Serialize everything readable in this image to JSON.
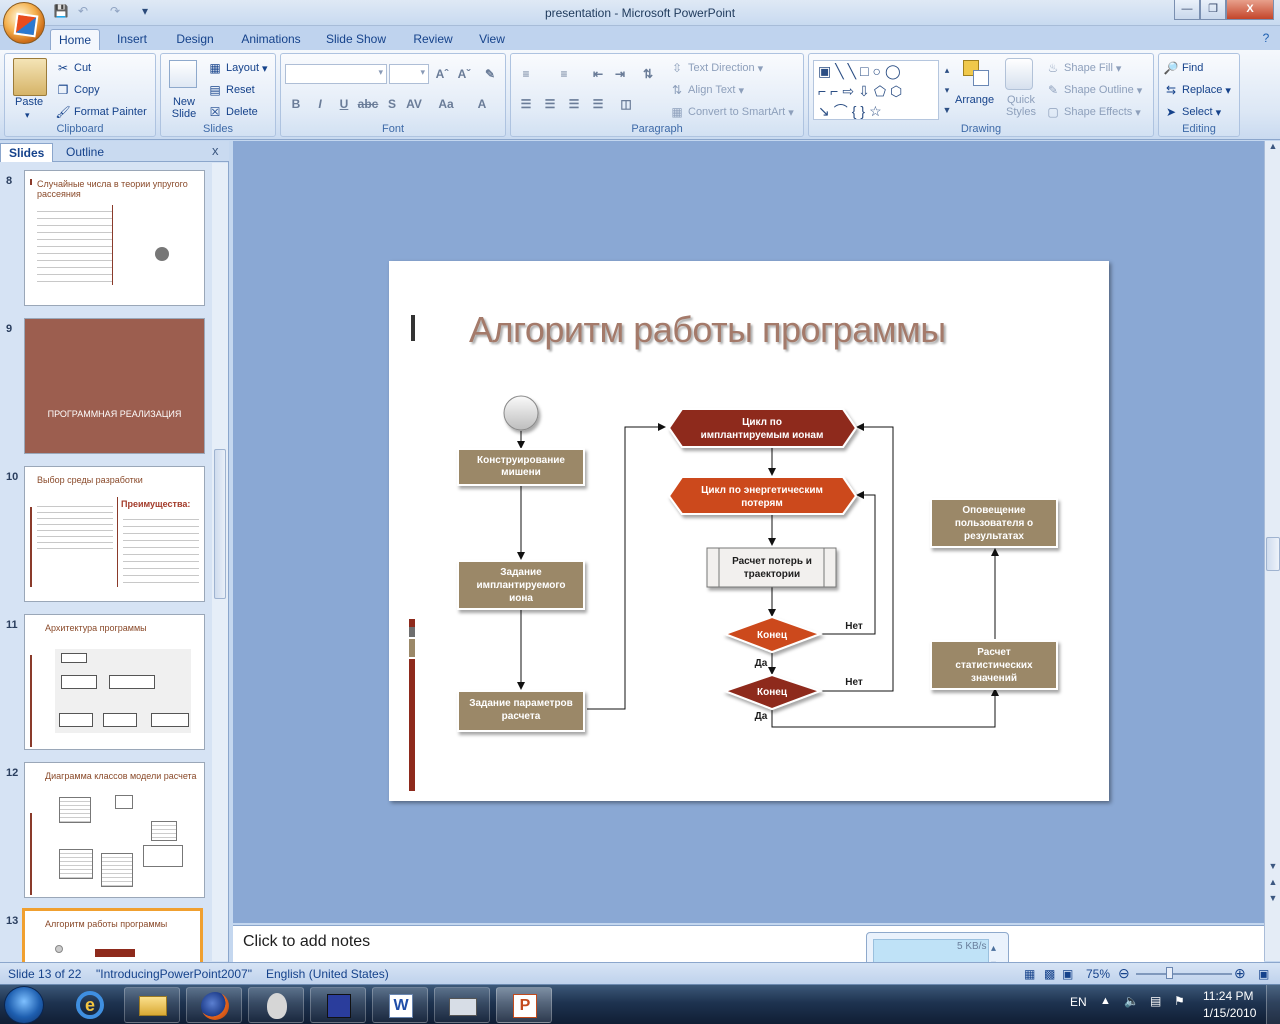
{
  "window": {
    "title": "presentation - Microsoft PowerPoint"
  },
  "qat": [
    "save-icon",
    "undo-icon",
    "redo-icon",
    "customize-icon"
  ],
  "tabs": [
    "Home",
    "Insert",
    "Design",
    "Animations",
    "Slide Show",
    "Review",
    "View"
  ],
  "active_tab": "Home",
  "ribbon": {
    "clipboard": {
      "label": "Clipboard",
      "paste": "Paste",
      "cut": "Cut",
      "copy": "Copy",
      "format_painter": "Format Painter"
    },
    "slides": {
      "label": "Slides",
      "new_slide": "New Slide",
      "layout": "Layout",
      "reset": "Reset",
      "delete": "Delete"
    },
    "font": {
      "label": "Font"
    },
    "paragraph": {
      "label": "Paragraph",
      "text_direction": "Text Direction",
      "align_text": "Align Text",
      "convert_smartart": "Convert to SmartArt"
    },
    "drawing": {
      "label": "Drawing",
      "arrange": "Arrange",
      "quick_styles": "Quick Styles",
      "shape_fill": "Shape Fill",
      "shape_outline": "Shape Outline",
      "shape_effects": "Shape Effects"
    },
    "editing": {
      "label": "Editing",
      "find": "Find",
      "replace": "Replace",
      "select": "Select"
    }
  },
  "pane": {
    "tab_slides": "Slides",
    "tab_outline": "Outline",
    "close": "x"
  },
  "thumbnails": [
    {
      "num": "8",
      "title": "Случайные числа в теории упругого рассеяния"
    },
    {
      "num": "9",
      "title": "ПРОГРАММНАЯ РЕАЛИЗАЦИЯ"
    },
    {
      "num": "10",
      "title": "Выбор среды разработки",
      "side": "Преимущества:"
    },
    {
      "num": "11",
      "title": "Архитектура программы"
    },
    {
      "num": "12",
      "title": "Диаграмма классов модели расчета"
    },
    {
      "num": "13",
      "title": "Алгоритм работы программы"
    }
  ],
  "slide": {
    "title": "Алгоритм работы программы",
    "nodes": {
      "construct": [
        "Конструирование",
        "мишени"
      ],
      "implant": [
        "Задание",
        "имплантируемого",
        "иона"
      ],
      "params": [
        "Задание параметров",
        "расчета"
      ],
      "loop_ions": [
        "Цикл по",
        "имплантируемым ионам"
      ],
      "loop_energy": [
        "Цикл по энергетическим",
        "потерям"
      ],
      "calc_loss": [
        "Расчет потерь и",
        "траектории"
      ],
      "end1": "Конец",
      "end2": "Конец",
      "stats": [
        "Расчет",
        "статистических",
        "значений"
      ],
      "notify": [
        "Оповещение",
        "пользователя о",
        "результатах"
      ]
    },
    "labels": {
      "no1": "Нет",
      "no2": "Нет",
      "yes1": "Да",
      "yes2": "Да"
    },
    "colors": {
      "tan": "#9b8868",
      "dark_red": "#8e2a1c",
      "orange_red": "#cc4a1c"
    }
  },
  "notes": "Click to add notes",
  "status": {
    "slide": "Slide 13 of 22",
    "theme": "\"IntroducingPowerPoint2007\"",
    "language": "English (United States)",
    "zoom": "75%"
  },
  "net_meter": "5 KB/s",
  "tray": {
    "lang": "EN",
    "time": "11:24 PM",
    "date": "1/15/2010"
  }
}
